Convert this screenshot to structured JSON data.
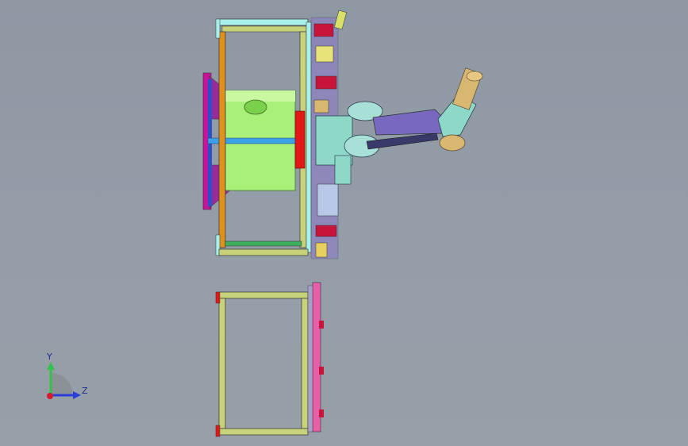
{
  "viewport": {
    "background_top": "#8e98a3",
    "background_bottom": "#979fa8"
  },
  "triad": {
    "y_label": "Y",
    "z_label": "Z",
    "y_color": "#35c24a",
    "z_color": "#2a3fd8",
    "origin_color": "#d8182c"
  },
  "model": {
    "frame_colors": {
      "cyan": "#a8f0ea",
      "orange": "#e0901c",
      "olive": "#c8d27a",
      "green": "#3fae5a",
      "magenta": "#c8149a",
      "pink": "#e85fa8",
      "drum": "#a8f07a",
      "blue": "#3aa0e8",
      "red": "#e01818",
      "purple": "#8a78c8",
      "teal": "#8ed8c8",
      "tan": "#d8b870"
    }
  }
}
